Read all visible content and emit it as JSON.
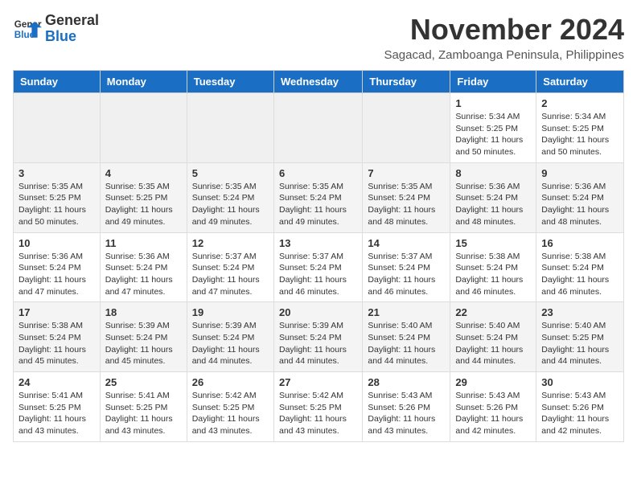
{
  "logo": {
    "line1": "General",
    "line2": "Blue"
  },
  "title": "November 2024",
  "subtitle": "Sagacad, Zamboanga Peninsula, Philippines",
  "weekdays": [
    "Sunday",
    "Monday",
    "Tuesday",
    "Wednesday",
    "Thursday",
    "Friday",
    "Saturday"
  ],
  "weeks": [
    [
      {
        "day": "",
        "info": ""
      },
      {
        "day": "",
        "info": ""
      },
      {
        "day": "",
        "info": ""
      },
      {
        "day": "",
        "info": ""
      },
      {
        "day": "",
        "info": ""
      },
      {
        "day": "1",
        "info": "Sunrise: 5:34 AM\nSunset: 5:25 PM\nDaylight: 11 hours\nand 50 minutes."
      },
      {
        "day": "2",
        "info": "Sunrise: 5:34 AM\nSunset: 5:25 PM\nDaylight: 11 hours\nand 50 minutes."
      }
    ],
    [
      {
        "day": "3",
        "info": "Sunrise: 5:35 AM\nSunset: 5:25 PM\nDaylight: 11 hours\nand 50 minutes."
      },
      {
        "day": "4",
        "info": "Sunrise: 5:35 AM\nSunset: 5:25 PM\nDaylight: 11 hours\nand 49 minutes."
      },
      {
        "day": "5",
        "info": "Sunrise: 5:35 AM\nSunset: 5:24 PM\nDaylight: 11 hours\nand 49 minutes."
      },
      {
        "day": "6",
        "info": "Sunrise: 5:35 AM\nSunset: 5:24 PM\nDaylight: 11 hours\nand 49 minutes."
      },
      {
        "day": "7",
        "info": "Sunrise: 5:35 AM\nSunset: 5:24 PM\nDaylight: 11 hours\nand 48 minutes."
      },
      {
        "day": "8",
        "info": "Sunrise: 5:36 AM\nSunset: 5:24 PM\nDaylight: 11 hours\nand 48 minutes."
      },
      {
        "day": "9",
        "info": "Sunrise: 5:36 AM\nSunset: 5:24 PM\nDaylight: 11 hours\nand 48 minutes."
      }
    ],
    [
      {
        "day": "10",
        "info": "Sunrise: 5:36 AM\nSunset: 5:24 PM\nDaylight: 11 hours\nand 47 minutes."
      },
      {
        "day": "11",
        "info": "Sunrise: 5:36 AM\nSunset: 5:24 PM\nDaylight: 11 hours\nand 47 minutes."
      },
      {
        "day": "12",
        "info": "Sunrise: 5:37 AM\nSunset: 5:24 PM\nDaylight: 11 hours\nand 47 minutes."
      },
      {
        "day": "13",
        "info": "Sunrise: 5:37 AM\nSunset: 5:24 PM\nDaylight: 11 hours\nand 46 minutes."
      },
      {
        "day": "14",
        "info": "Sunrise: 5:37 AM\nSunset: 5:24 PM\nDaylight: 11 hours\nand 46 minutes."
      },
      {
        "day": "15",
        "info": "Sunrise: 5:38 AM\nSunset: 5:24 PM\nDaylight: 11 hours\nand 46 minutes."
      },
      {
        "day": "16",
        "info": "Sunrise: 5:38 AM\nSunset: 5:24 PM\nDaylight: 11 hours\nand 46 minutes."
      }
    ],
    [
      {
        "day": "17",
        "info": "Sunrise: 5:38 AM\nSunset: 5:24 PM\nDaylight: 11 hours\nand 45 minutes."
      },
      {
        "day": "18",
        "info": "Sunrise: 5:39 AM\nSunset: 5:24 PM\nDaylight: 11 hours\nand 45 minutes."
      },
      {
        "day": "19",
        "info": "Sunrise: 5:39 AM\nSunset: 5:24 PM\nDaylight: 11 hours\nand 44 minutes."
      },
      {
        "day": "20",
        "info": "Sunrise: 5:39 AM\nSunset: 5:24 PM\nDaylight: 11 hours\nand 44 minutes."
      },
      {
        "day": "21",
        "info": "Sunrise: 5:40 AM\nSunset: 5:24 PM\nDaylight: 11 hours\nand 44 minutes."
      },
      {
        "day": "22",
        "info": "Sunrise: 5:40 AM\nSunset: 5:24 PM\nDaylight: 11 hours\nand 44 minutes."
      },
      {
        "day": "23",
        "info": "Sunrise: 5:40 AM\nSunset: 5:25 PM\nDaylight: 11 hours\nand 44 minutes."
      }
    ],
    [
      {
        "day": "24",
        "info": "Sunrise: 5:41 AM\nSunset: 5:25 PM\nDaylight: 11 hours\nand 43 minutes."
      },
      {
        "day": "25",
        "info": "Sunrise: 5:41 AM\nSunset: 5:25 PM\nDaylight: 11 hours\nand 43 minutes."
      },
      {
        "day": "26",
        "info": "Sunrise: 5:42 AM\nSunset: 5:25 PM\nDaylight: 11 hours\nand 43 minutes."
      },
      {
        "day": "27",
        "info": "Sunrise: 5:42 AM\nSunset: 5:25 PM\nDaylight: 11 hours\nand 43 minutes."
      },
      {
        "day": "28",
        "info": "Sunrise: 5:43 AM\nSunset: 5:26 PM\nDaylight: 11 hours\nand 43 minutes."
      },
      {
        "day": "29",
        "info": "Sunrise: 5:43 AM\nSunset: 5:26 PM\nDaylight: 11 hours\nand 42 minutes."
      },
      {
        "day": "30",
        "info": "Sunrise: 5:43 AM\nSunset: 5:26 PM\nDaylight: 11 hours\nand 42 minutes."
      }
    ]
  ]
}
